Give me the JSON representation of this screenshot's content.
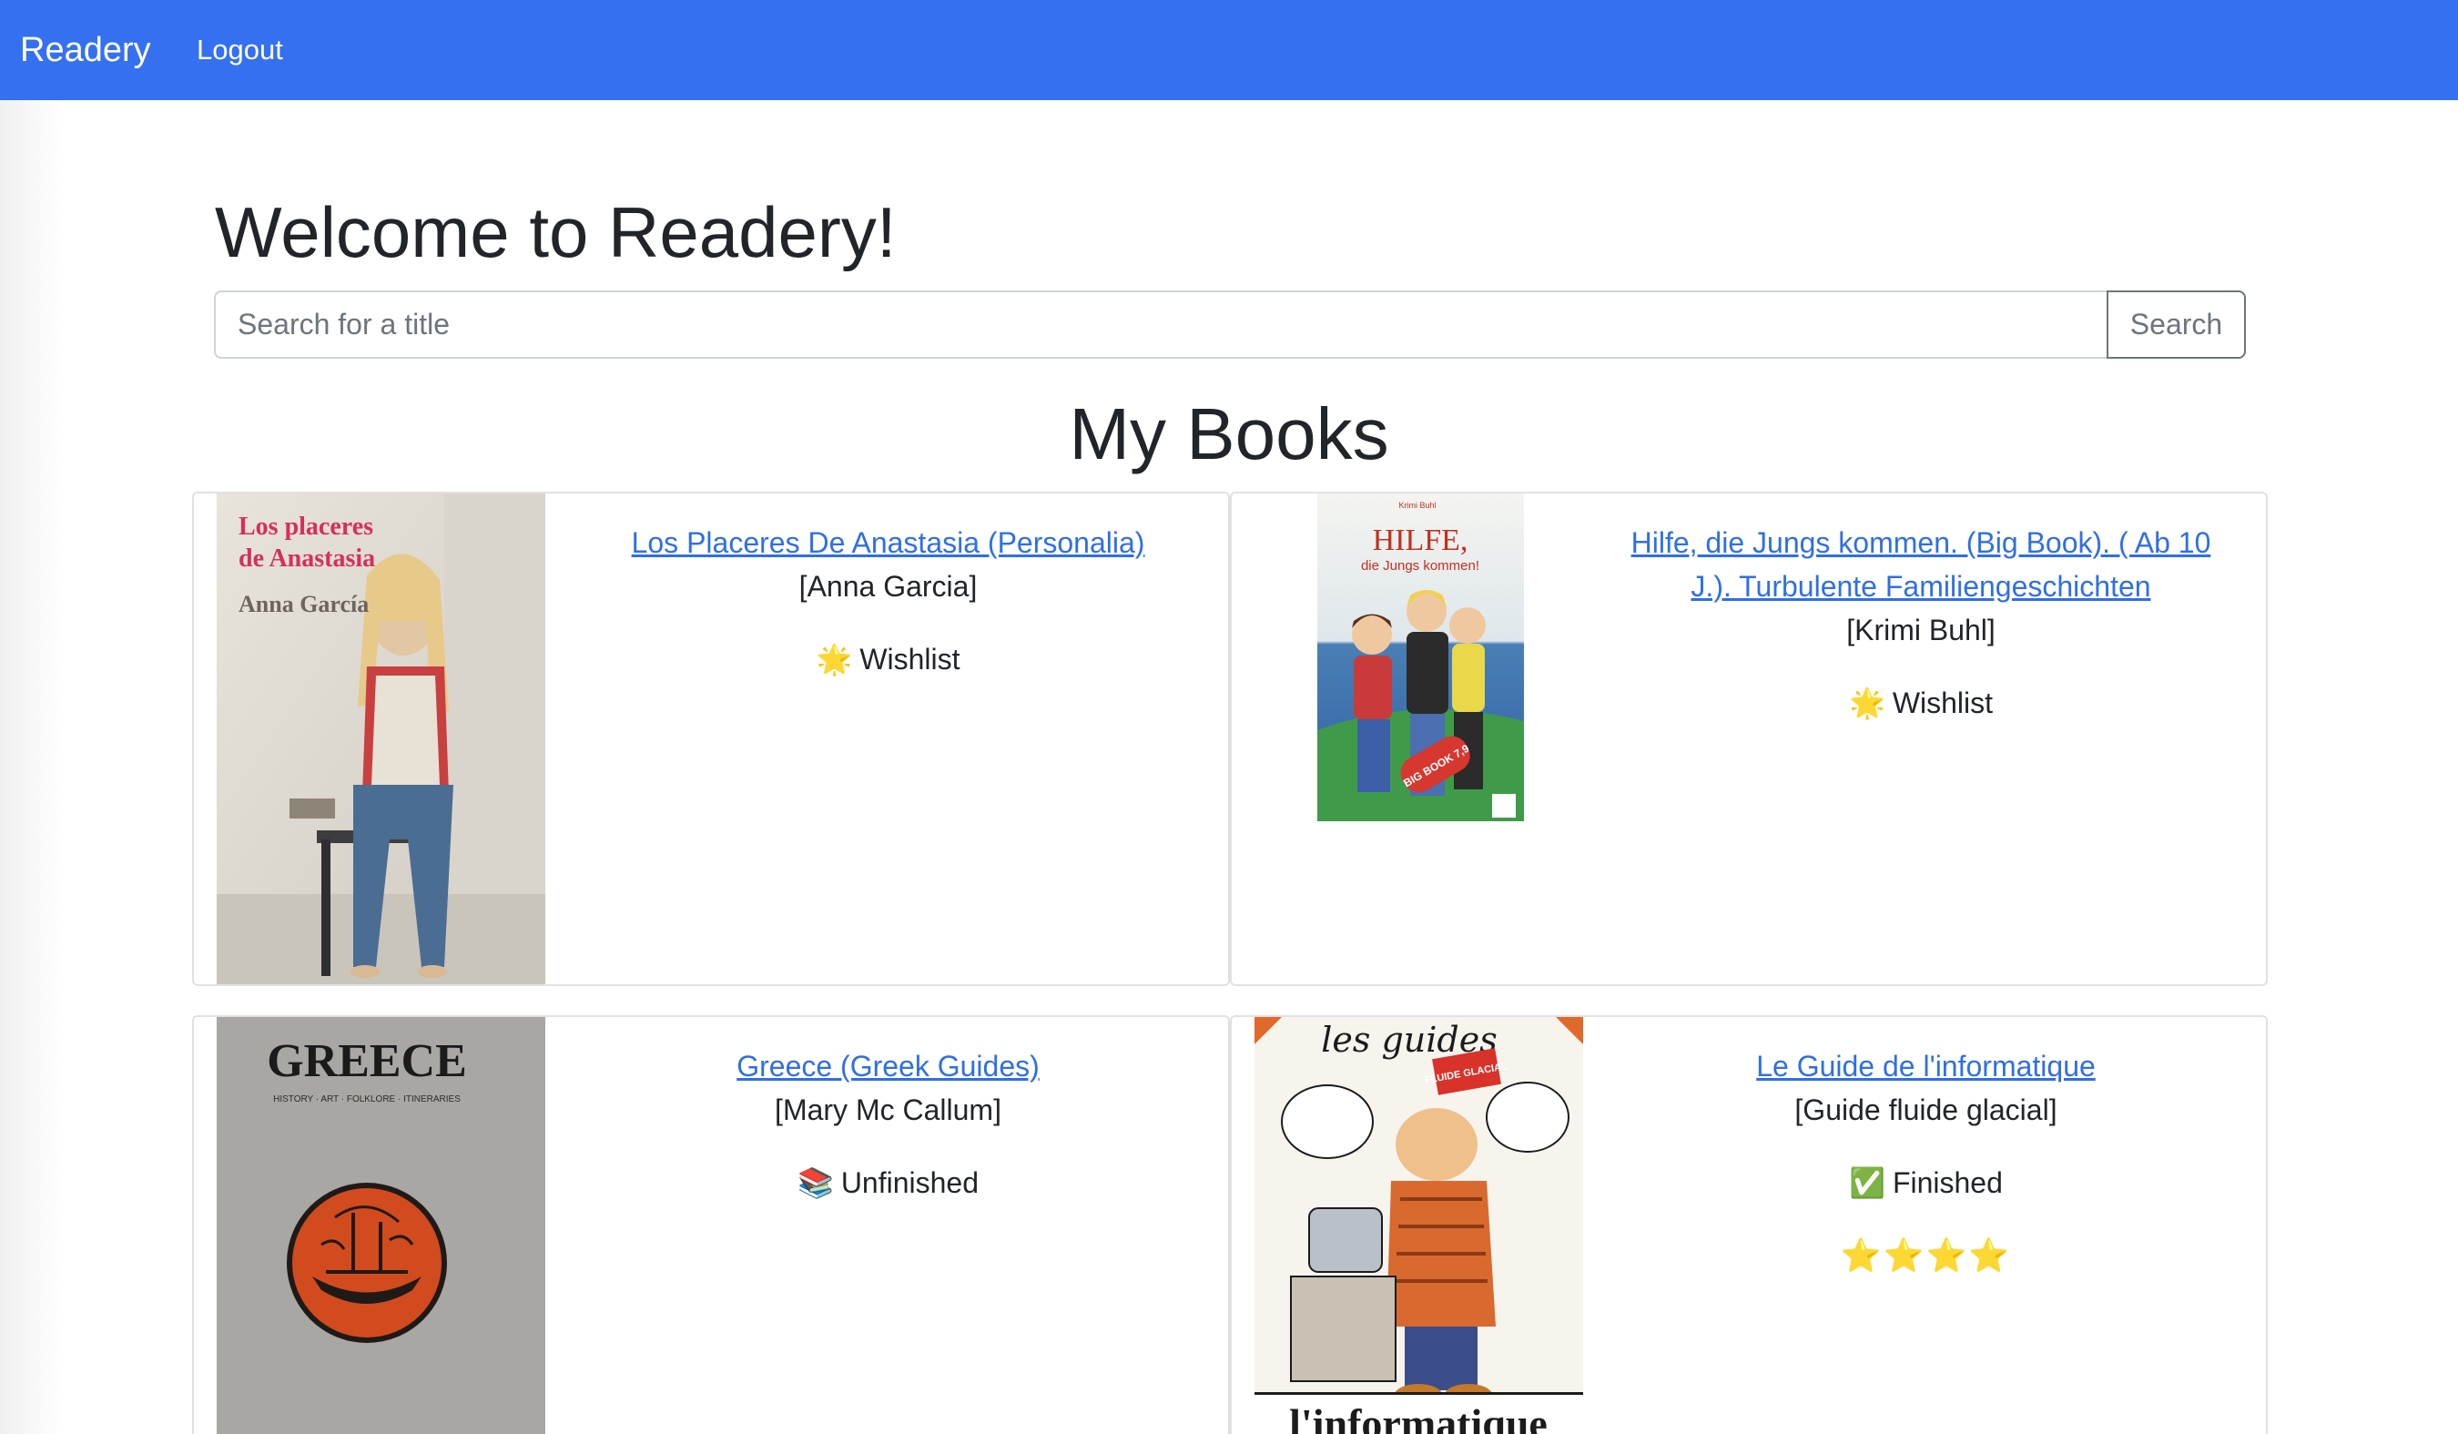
{
  "navbar": {
    "brand": "Readery",
    "logout": "Logout",
    "color": "#3570f0"
  },
  "welcome_title": "Welcome to Readery!",
  "search": {
    "placeholder": "Search for a title",
    "value": "",
    "button_label": "Search"
  },
  "section_title": "My Books",
  "books": [
    {
      "title": "Los Placeres De Anastasia (Personalia)",
      "author": "[Anna Garcia]",
      "status_icon": "🌟",
      "status_icon_name": "glowing-star-icon",
      "status": "Wishlist",
      "rating": "",
      "cover": {
        "title_line1": "Los placeres",
        "title_line2": "de Anastasia",
        "author": "Anna García"
      }
    },
    {
      "title": "Hilfe, die Jungs kommen. (Big Book). ( Ab 10 J.). Turbulente Familiengeschichten",
      "author": "[Krimi Buhl]",
      "status_icon": "🌟",
      "status_icon_name": "glowing-star-icon",
      "status": "Wishlist",
      "rating": "",
      "cover": {
        "author": "Krimi Buhl",
        "title": "HILFE,",
        "subtitle": "die Jungs kommen!",
        "badge": "BIG BOOK 7,9"
      }
    },
    {
      "title": "Greece (Greek Guides)",
      "author": "[Mary Mc Callum]",
      "status_icon": "📚",
      "status_icon_name": "books-icon",
      "status": "Unfinished",
      "rating": "",
      "cover": {
        "title": "GREECE",
        "subtitle": "HISTORY · ART · FOLKLORE · ITINERARIES"
      }
    },
    {
      "title": "Le Guide de l'informatique",
      "author": "[Guide fluide glacial]",
      "status_icon": "✅",
      "status_icon_name": "check-mark-icon",
      "status": "Finished",
      "rating": "⭐⭐⭐⭐",
      "cover": {
        "header": "les guides",
        "badge": "FLUIDE GLACIAL",
        "title": "l'informatique"
      }
    }
  ]
}
